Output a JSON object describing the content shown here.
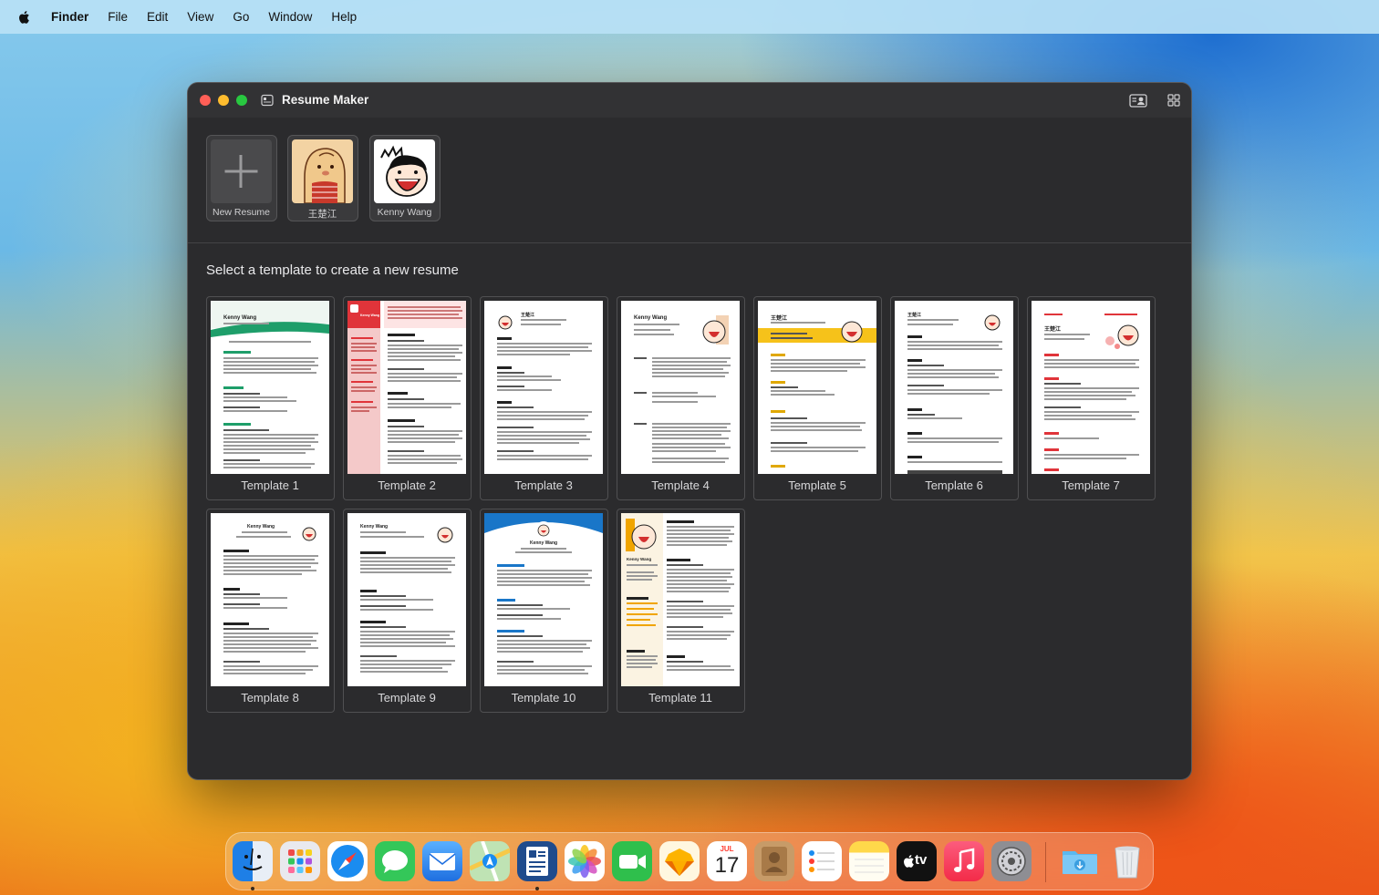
{
  "menubar": {
    "app": "Finder",
    "items": [
      "File",
      "Edit",
      "View",
      "Go",
      "Window",
      "Help"
    ]
  },
  "window": {
    "title": "Resume Maker",
    "resumes": [
      {
        "label": "New Resume",
        "icon": "plus-icon"
      },
      {
        "label": "王楚江",
        "icon": "avatar-illustration"
      },
      {
        "label": "Kenny Wang",
        "icon": "avatar-illustration"
      }
    ],
    "section_title": "Select a template to create a new resume",
    "templates": [
      {
        "label": "Template 1",
        "name": "Kenny Wang",
        "style": "green-wave-header",
        "accent": "#1e9e6a"
      },
      {
        "label": "Template 2",
        "name": "Kenny Wang",
        "style": "red-sidebar",
        "accent": "#e0343a"
      },
      {
        "label": "Template 3",
        "name": "王楚江",
        "style": "plain-photo-left",
        "accent": "#444444"
      },
      {
        "label": "Template 4",
        "name": "Kenny Wang",
        "style": "side-headings",
        "accent": "#a0522d"
      },
      {
        "label": "Template 5",
        "name": "王楚江",
        "style": "yellow-band",
        "accent": "#f6c21a"
      },
      {
        "label": "Template 6",
        "name": "王楚江",
        "style": "plain-photo-right",
        "accent": "#333333"
      },
      {
        "label": "Template 7",
        "name": "王楚江",
        "style": "red-accents",
        "accent": "#e0343a"
      },
      {
        "label": "Template 8",
        "name": "Kenny Wang",
        "style": "centered-header",
        "accent": "#333333"
      },
      {
        "label": "Template 9",
        "name": "Kenny Wang",
        "style": "left-header",
        "accent": "#333333"
      },
      {
        "label": "Template 10",
        "name": "Kenny Wang",
        "style": "blue-arc-header",
        "accent": "#1976c8"
      },
      {
        "label": "Template 11",
        "name": "Kenny Wang",
        "style": "yellow-sidebar",
        "accent": "#f0a500"
      }
    ]
  },
  "dock": {
    "apps": [
      {
        "name": "Finder",
        "icon": "finder-icon",
        "color": "#2f8ef0",
        "running": true
      },
      {
        "name": "Launchpad",
        "icon": "launchpad-icon",
        "color": "#e9e9ee",
        "running": false
      },
      {
        "name": "Safari",
        "icon": "safari-icon",
        "color": "#1a8cf0",
        "running": false
      },
      {
        "name": "Messages",
        "icon": "messages-icon",
        "color": "#34c759",
        "running": false
      },
      {
        "name": "Mail",
        "icon": "mail-icon",
        "color": "#1e7cf0",
        "running": false
      },
      {
        "name": "Maps",
        "icon": "maps-icon",
        "color": "#5ec470",
        "running": false
      },
      {
        "name": "Resume Maker",
        "icon": "resume-maker-icon",
        "color": "#1f4b8c",
        "running": true
      },
      {
        "name": "Photos",
        "icon": "photos-icon",
        "color": "#ffffff",
        "running": false
      },
      {
        "name": "FaceTime",
        "icon": "facetime-icon",
        "color": "#2fbf4c",
        "running": false
      },
      {
        "name": "Sketch",
        "icon": "sketch-icon",
        "color": "#fdb300",
        "running": false
      },
      {
        "name": "Calendar",
        "icon": "calendar-icon",
        "color": "#ffffff",
        "running": false,
        "month": "JUL",
        "day": "17"
      },
      {
        "name": "Contacts",
        "icon": "contacts-icon",
        "color": "#b3895a",
        "running": false
      },
      {
        "name": "Reminders",
        "icon": "reminders-icon",
        "color": "#ffffff",
        "running": false
      },
      {
        "name": "Notes",
        "icon": "notes-icon",
        "color": "#ffd84a",
        "running": false
      },
      {
        "name": "TV",
        "icon": "apple-tv-icon",
        "color": "#111111",
        "running": false,
        "text": "tv"
      },
      {
        "name": "Music",
        "icon": "music-icon",
        "color": "#fa2d48",
        "running": false
      },
      {
        "name": "System Settings",
        "icon": "system-settings-icon",
        "color": "#8e8e93",
        "running": false
      }
    ],
    "right": [
      {
        "name": "Downloads",
        "icon": "downloads-folder-icon",
        "color": "#5bb8ef"
      },
      {
        "name": "Trash",
        "icon": "trash-icon",
        "color": "#e9ecef"
      }
    ]
  }
}
